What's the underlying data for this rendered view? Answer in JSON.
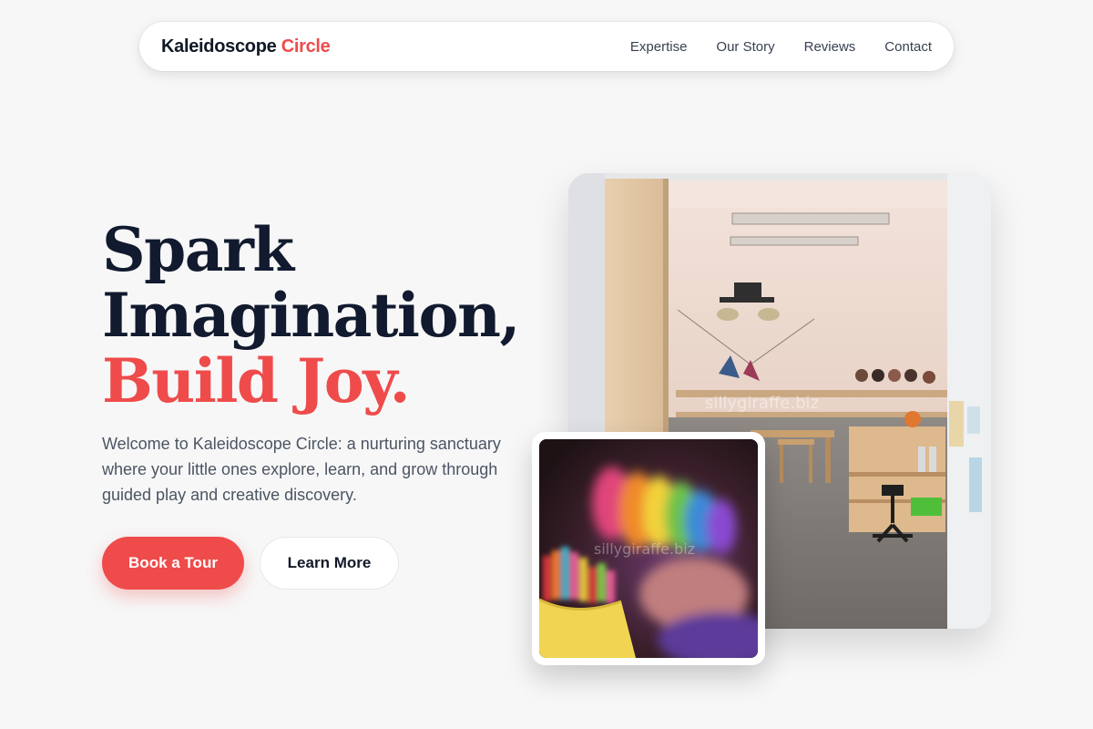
{
  "nav": {
    "brand_part1": "Kaleidoscope",
    "brand_part2": "Circle",
    "links": [
      "Expertise",
      "Our Story",
      "Reviews",
      "Contact"
    ]
  },
  "hero": {
    "title_line1": "Spark",
    "title_line2": "Imagination,",
    "title_line3": "Build Joy.",
    "description": "Welcome to Kaleidoscope Circle: a nurturing sanctuary where your little ones explore, learn, and grow through guided play and creative discovery.",
    "primary_button": "Book a Tour",
    "secondary_button": "Learn More"
  },
  "images": {
    "watermark": "sillygiraffe.biz"
  },
  "colors": {
    "accent": "#ef4b4b",
    "heading": "#111a2e",
    "body_text": "#4b5563",
    "background": "#f7f7f7"
  }
}
